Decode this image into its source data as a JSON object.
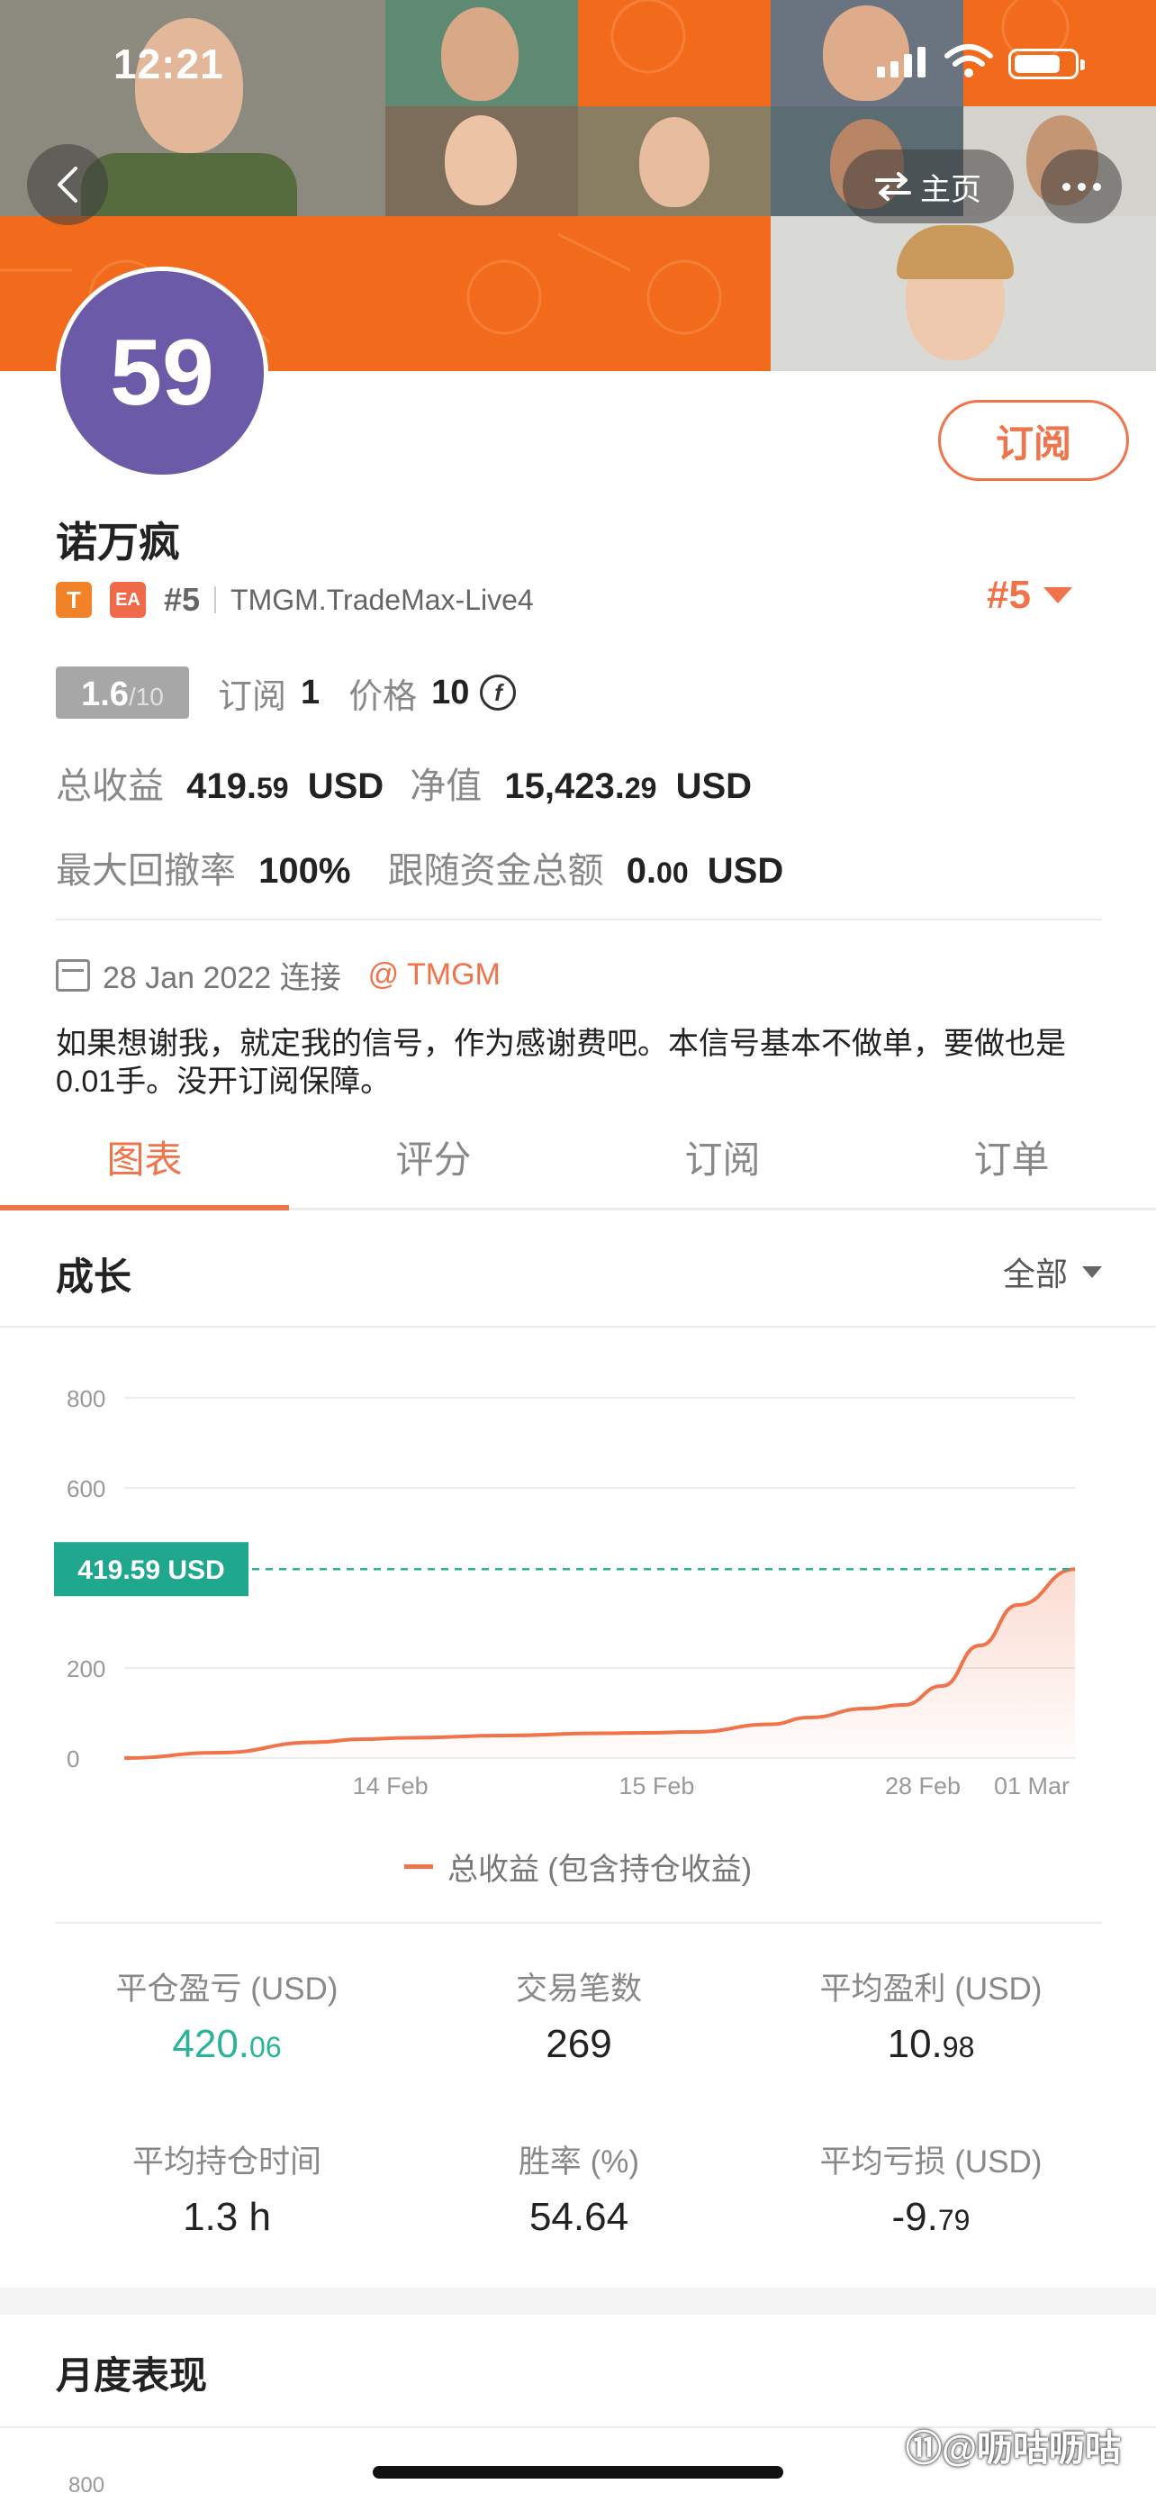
{
  "status_bar": {
    "time": "12:21"
  },
  "nav": {
    "home_label": "主页"
  },
  "profile": {
    "avatar_text": "59",
    "name": "诺万疯",
    "tag_t": "T",
    "tag_ea": "EA",
    "rank": "#5",
    "server": "TMGM.TradeMax-Live4",
    "rank_big": "#5",
    "subscribe_label": "订阅"
  },
  "stats": {
    "score": "1.6",
    "score_max": "/10",
    "subscribe_label": "订阅",
    "subscribe_count": "1",
    "price_label": "价格",
    "price_value": "10",
    "coin_symbol": "f",
    "total_profit_label": "总收益",
    "total_profit_int": "419.",
    "total_profit_dec": "59",
    "total_profit_unit": "USD",
    "equity_label": "净值",
    "equity_int": "15,423.",
    "equity_dec": "29",
    "equity_unit": "USD",
    "drawdown_label": "最大回撤率",
    "drawdown_value": "100%",
    "follow_label": "跟随资金总额",
    "follow_int": "0.",
    "follow_dec": "00",
    "follow_unit": "USD"
  },
  "connection": {
    "date": "28 Jan 2022 连接",
    "broker": "@ TMGM"
  },
  "description": "如果想谢我，就定我的信号，作为感谢费吧。本信号基本不做单，要做也是0.01手。没开订阅保障。",
  "tabs": [
    {
      "label": "图表"
    },
    {
      "label": "评分"
    },
    {
      "label": "订阅"
    },
    {
      "label": "订单"
    }
  ],
  "growth": {
    "title": "成长",
    "range": "全部",
    "legend": "总收益 (包含持仓收益)",
    "current_label": "419.59 USD"
  },
  "chart_data": {
    "type": "area",
    "title": "",
    "xlabel": "",
    "ylabel": "",
    "ylim": [
      0,
      800
    ],
    "yticks": [
      "800",
      "600",
      "200",
      "0"
    ],
    "ytick_values": [
      800,
      600,
      200,
      0
    ],
    "xticks": [
      "14 Feb",
      "15 Feb",
      "28 Feb",
      "01 Mar"
    ],
    "reference_line": 419.59,
    "grid": true,
    "series": [
      {
        "name": "总收益 (包含持仓收益)",
        "color": "#f0734a",
        "x": [
          0,
          0.1,
          0.2,
          0.25,
          0.3,
          0.4,
          0.5,
          0.55,
          0.6,
          0.68,
          0.72,
          0.78,
          0.82,
          0.86,
          0.9,
          0.94,
          1.0
        ],
        "y": [
          0,
          12,
          35,
          42,
          45,
          50,
          55,
          56,
          58,
          75,
          90,
          110,
          118,
          160,
          250,
          340,
          419.59
        ]
      }
    ]
  },
  "metrics": [
    {
      "label": "平仓盈亏 (USD)",
      "int": "420.",
      "dec": "06",
      "style": "green"
    },
    {
      "label": "交易笔数",
      "int": "269",
      "dec": "",
      "style": ""
    },
    {
      "label": "平均盈利 (USD)",
      "int": "10.",
      "dec": "98",
      "style": ""
    },
    {
      "label": "平均持仓时间",
      "int": "1.3 h",
      "dec": "",
      "style": ""
    },
    {
      "label": "胜率 (%)",
      "int": "54.64",
      "dec": "",
      "style": ""
    },
    {
      "label": "平均亏损 (USD)",
      "int": "-9.",
      "dec": "79",
      "style": ""
    }
  ],
  "monthly": {
    "title": "月度表现",
    "tick": "800"
  },
  "watermark": "⑪@呖咕呖咕",
  "colors": {
    "brand_orange": "#f0734a",
    "banner_orange": "#f26a1c",
    "avatar_purple": "#6a5aa8",
    "green": "#2bb39a"
  }
}
